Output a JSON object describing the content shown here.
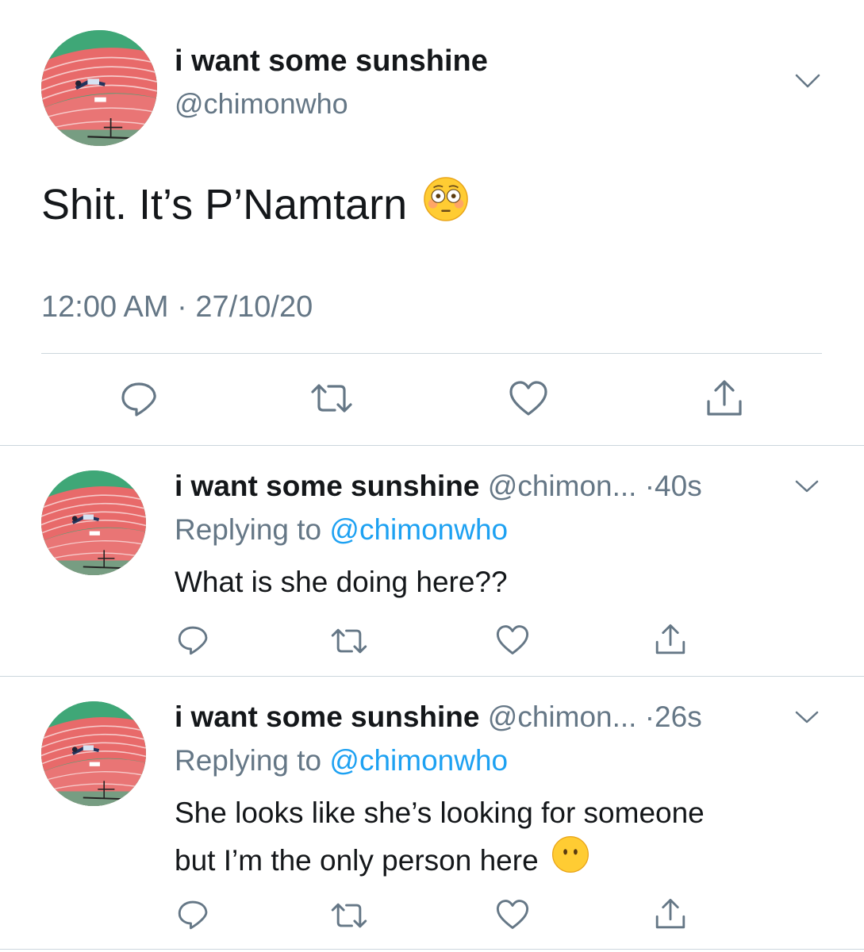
{
  "main_tweet": {
    "display_name": "i want some sunshine",
    "handle": "@chimonwho",
    "text": "Shit. It’s P’Namtarn",
    "emoji": "flushed-face",
    "timestamp": "12:00 AM · 27/10/20",
    "actions": [
      "reply-icon",
      "retweet-icon",
      "like-icon",
      "share-icon"
    ]
  },
  "replies": [
    {
      "display_name": "i want some sunshine",
      "handle_time": "@chimon... ·40s",
      "replying_prefix": "Replying to ",
      "replying_to": "@chimonwho",
      "text_lines": [
        "What is she doing here??"
      ],
      "emoji": ""
    },
    {
      "display_name": "i want some sunshine",
      "handle_time": "@chimon... ·26s",
      "replying_prefix": "Replying to ",
      "replying_to": "@chimonwho",
      "text_lines": [
        "She looks like she’s looking for someone",
        "but I’m the only person here"
      ],
      "emoji": "hushed-face"
    }
  ],
  "colors": {
    "text_primary": "#14171a",
    "text_secondary": "#657786",
    "link": "#1da1f2",
    "divider": "#ccd6dd",
    "icon": "#657786"
  }
}
